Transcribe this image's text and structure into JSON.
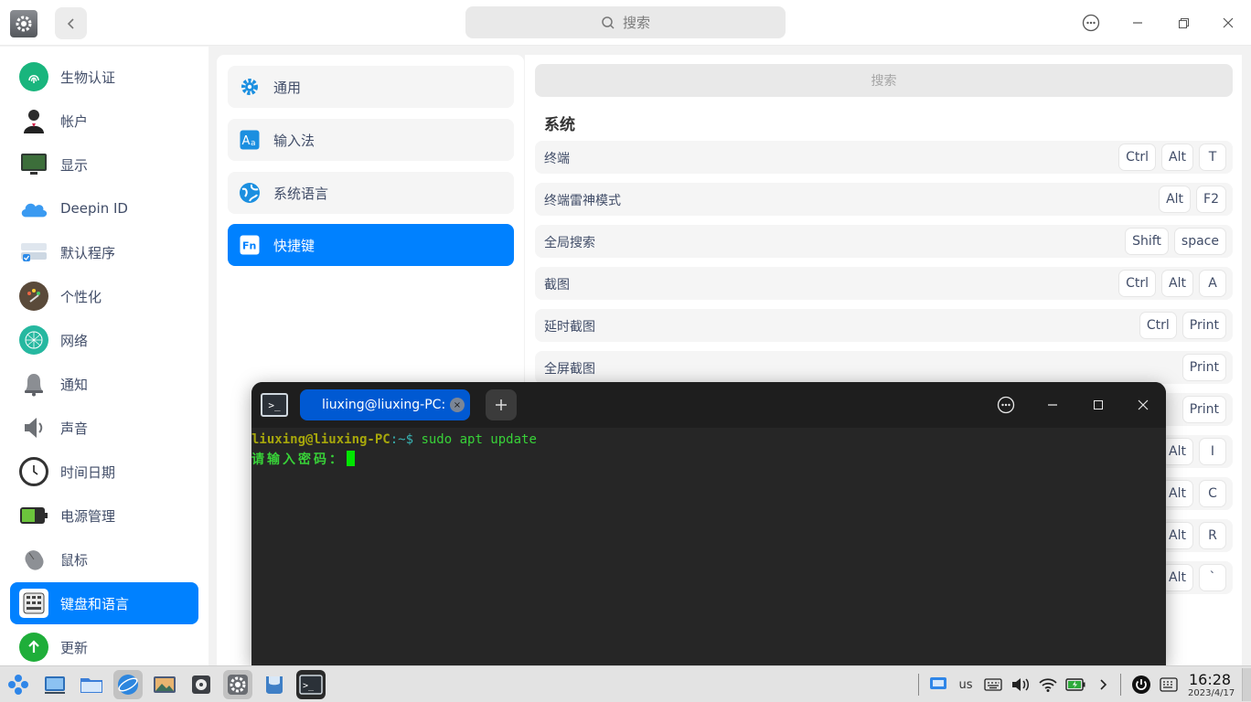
{
  "titlebar": {
    "search_placeholder": "搜索"
  },
  "sidebar": {
    "items": [
      {
        "label": "生物认证",
        "icon": "fingerprint-icon"
      },
      {
        "label": "帐户",
        "icon": "account-icon"
      },
      {
        "label": "显示",
        "icon": "display-icon"
      },
      {
        "label": "Deepin ID",
        "icon": "cloud-icon"
      },
      {
        "label": "默认程序",
        "icon": "default-apps-icon"
      },
      {
        "label": "个性化",
        "icon": "palette-icon"
      },
      {
        "label": "网络",
        "icon": "network-icon"
      },
      {
        "label": "通知",
        "icon": "bell-icon"
      },
      {
        "label": "声音",
        "icon": "speaker-icon"
      },
      {
        "label": "时间日期",
        "icon": "clock-icon"
      },
      {
        "label": "电源管理",
        "icon": "battery-icon"
      },
      {
        "label": "鼠标",
        "icon": "mouse-icon"
      },
      {
        "label": "键盘和语言",
        "icon": "keyboard-icon",
        "active": true
      },
      {
        "label": "更新",
        "icon": "update-icon"
      }
    ]
  },
  "middle": {
    "items": [
      {
        "label": "通用",
        "icon": "gear-icon"
      },
      {
        "label": "输入法",
        "icon": "input-method-icon"
      },
      {
        "label": "系统语言",
        "icon": "globe-icon"
      },
      {
        "label": "快捷键",
        "icon": "fn-key-icon",
        "active": true
      }
    ]
  },
  "shortcuts": {
    "search_placeholder": "搜索",
    "section_title": "系统",
    "rows": [
      {
        "name": "终端",
        "keys": [
          "Ctrl",
          "Alt",
          "T"
        ]
      },
      {
        "name": "终端雷神模式",
        "keys": [
          "Alt",
          "F2"
        ]
      },
      {
        "name": "全局搜索",
        "keys": [
          "Shift",
          "space"
        ]
      },
      {
        "name": "截图",
        "keys": [
          "Ctrl",
          "Alt",
          "A"
        ]
      },
      {
        "name": "延时截图",
        "keys": [
          "Ctrl",
          "Print"
        ]
      },
      {
        "name": "全屏截图",
        "keys": [
          "Print"
        ]
      },
      {
        "name": "",
        "keys": [
          "Print"
        ]
      },
      {
        "name": "",
        "keys": [
          "Alt",
          "I"
        ]
      },
      {
        "name": "",
        "keys": [
          "Alt",
          "C"
        ]
      },
      {
        "name": "",
        "keys": [
          "Alt",
          "R"
        ]
      },
      {
        "name": "",
        "keys": [
          "Alt",
          "`"
        ]
      }
    ]
  },
  "terminal": {
    "tab_title": "liuxing@liuxing-PC: ~",
    "prompt_user": "liuxing@liuxing-PC",
    "prompt_sep": ":~$",
    "command": " sudo apt update",
    "password_prompt": "请输入密码："
  },
  "taskbar": {
    "keyboard_layout": "us",
    "time": "16:28",
    "date": "2023/4/17"
  },
  "colors": {
    "accent": "#0081ff",
    "terminal_bg": "#262626",
    "terminal_green": "#38d138",
    "terminal_user": "#a7a70b"
  }
}
